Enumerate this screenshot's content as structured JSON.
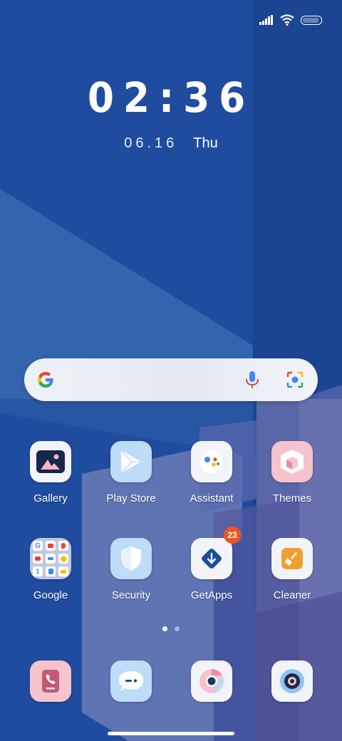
{
  "status_bar": {
    "signal_icon": "signal-bars-icon",
    "wifi_icon": "wifi-icon",
    "battery_icon": "battery-icon"
  },
  "clock": {
    "time": "02:36",
    "date": "06.16",
    "weekday": "Thu"
  },
  "search": {
    "logo": "google-g-icon",
    "mic_icon": "microphone-icon",
    "lens_icon": "camera-lens-icon"
  },
  "apps_row1": [
    {
      "label": "Gallery",
      "icon": "gallery-icon"
    },
    {
      "label": "Play Store",
      "icon": "play-store-icon"
    },
    {
      "label": "Assistant",
      "icon": "assistant-icon"
    },
    {
      "label": "Themes",
      "icon": "themes-icon"
    }
  ],
  "apps_row2": [
    {
      "label": "Google",
      "icon": "google-folder-icon"
    },
    {
      "label": "Security",
      "icon": "shield-icon"
    },
    {
      "label": "GetApps",
      "icon": "download-arrow-icon",
      "badge": "23"
    },
    {
      "label": "Cleaner",
      "icon": "broom-icon"
    }
  ],
  "dock": [
    {
      "icon": "phone-icon"
    },
    {
      "icon": "messages-icon"
    },
    {
      "icon": "chrome-icon"
    },
    {
      "icon": "camera-icon"
    }
  ],
  "page_indicator": {
    "pages": 2,
    "current": 1
  },
  "colors": {
    "wallpaper": "#1f4c9e",
    "badge": "#f0541e",
    "accent_blue": "#1a4f97"
  }
}
